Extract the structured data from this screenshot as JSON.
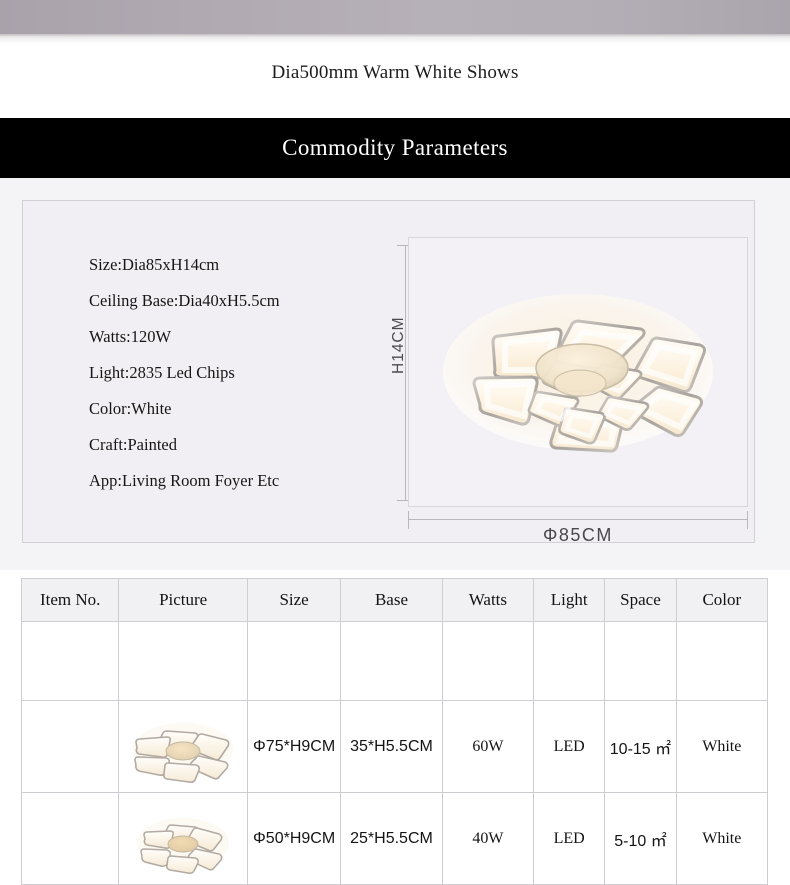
{
  "header": {
    "headline": "Dia500mm Warm White Shows",
    "banner_title": "Commodity Parameters"
  },
  "parameters": {
    "specs": [
      "Size:Dia85xH14cm",
      "Ceiling Base:Dia40xH5.5cm",
      "Watts:120W",
      "Light:2835 Led Chips",
      "Color:White",
      "Craft:Painted",
      "App:Living Room Foyer Etc"
    ],
    "dimension_height_label": "H14CM",
    "dimension_width_label": "Φ85CM",
    "product_image_alt": "led-ceiling-lamp-flower-petals"
  },
  "table": {
    "columns": [
      "Item No.",
      "Picture",
      "Size",
      "Base",
      "Watts",
      "Light",
      "Space",
      "Color"
    ],
    "rows": [
      {
        "item_no": "",
        "picture": "lamp-thumbnail-6-petal",
        "size": "Φ75*H9CM",
        "base": "35*H5.5CM",
        "watts": "60W",
        "light": "LED",
        "space": "10-15 ㎡",
        "color": "White"
      },
      {
        "item_no": "",
        "picture": "lamp-thumbnail-8-petal",
        "size": "Φ50*H9CM",
        "base": "25*H5.5CM",
        "watts": "40W",
        "light": "LED",
        "space": "5-10 ㎡",
        "color": "White"
      }
    ]
  },
  "colors": {
    "banner_bg": "#000000",
    "panel_bg": "#f4f3f5",
    "box_bg": "#f1eff3",
    "border": "#cfcdd1",
    "top_band": "#b0a9b2",
    "lamp_glow": "#f7e6c8"
  }
}
